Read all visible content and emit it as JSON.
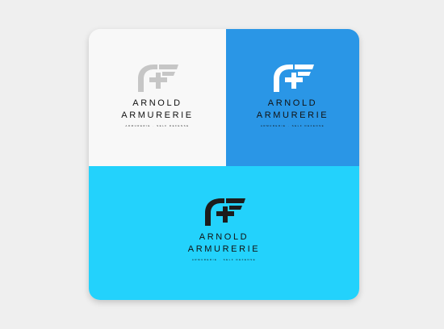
{
  "brand": {
    "line1": "ARNOLD",
    "line2": "ARMURERIE",
    "tagline": "ARMURERIE · SELF DEFENSE"
  },
  "colors": {
    "page_bg": "#efefef",
    "panel_white": "#f8f8f8",
    "panel_blue": "#2a96e6",
    "panel_cyan": "#23d2fc",
    "logo_gray": "#c6c6c6",
    "logo_white": "#ffffff",
    "text_black": "#111111",
    "text_dark": "#1c1c1c"
  },
  "panels": [
    {
      "id": "white",
      "mark_color": "logo_gray",
      "text_color": "text_black"
    },
    {
      "id": "blue",
      "mark_color": "logo_white",
      "text_color": "text_black"
    },
    {
      "id": "cyan",
      "mark_color": "text_dark",
      "text_color": "text_black"
    }
  ]
}
